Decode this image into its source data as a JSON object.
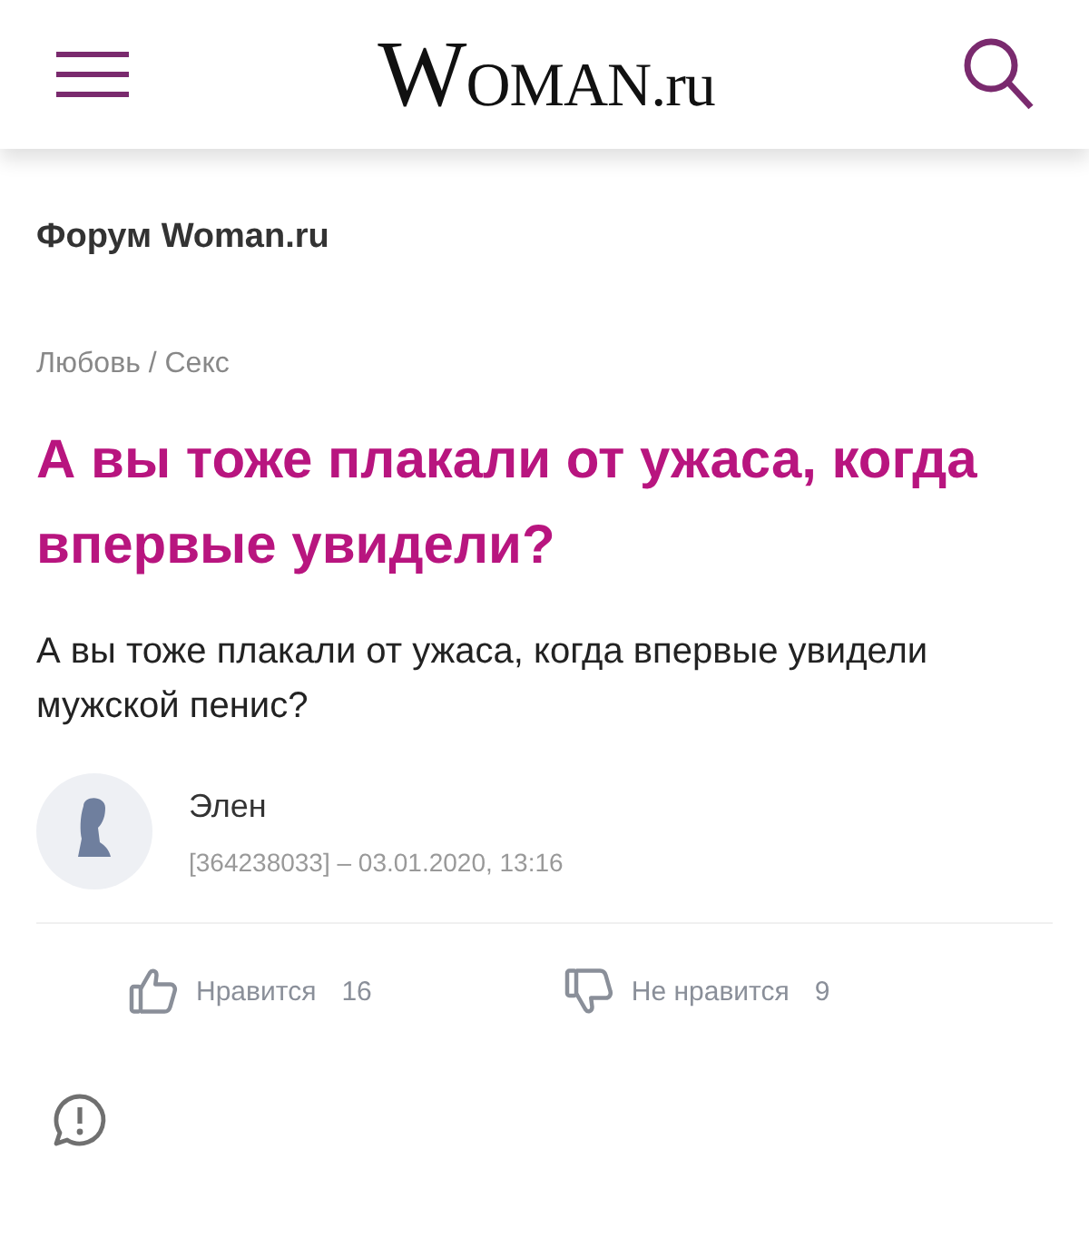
{
  "header": {
    "logo": "WOMAN.ru"
  },
  "forum_title": "Форум Woman.ru",
  "breadcrumb": "Любовь / Секс",
  "post": {
    "title": "А вы тоже плакали от ужаса, когда впервые увидели?",
    "body": "А вы тоже плакали от ужаса, когда впервые увидели мужской пенис?",
    "author": {
      "name": "Элен",
      "meta": "[364238033] – 03.01.2020, 13:16"
    },
    "reactions": [
      {
        "kind": "like",
        "label": "Нравится",
        "count": "16"
      },
      {
        "kind": "dislike",
        "label": "Не нравится",
        "count": "9"
      }
    ]
  }
}
